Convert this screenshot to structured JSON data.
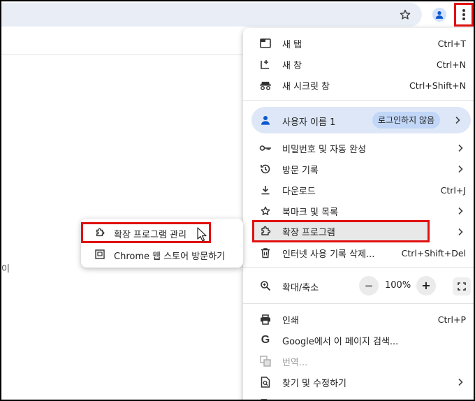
{
  "toolbar": {
    "bookmark_icon": "star-icon",
    "profile_icon": "profile-icon",
    "menu_icon": "kebab-menu-icon"
  },
  "page": {
    "fragment_text": "이"
  },
  "menu": {
    "new_tab": {
      "label": "새 탭",
      "shortcut": "Ctrl+T"
    },
    "new_window": {
      "label": "새 창",
      "shortcut": "Ctrl+N"
    },
    "incognito": {
      "label": "새 시크릿 창",
      "shortcut": "Ctrl+Shift+N"
    },
    "profile": {
      "name": "사용자 이름 1",
      "badge": "로그인하지 않음"
    },
    "passwords": {
      "label": "비밀번호 및 자동 완성"
    },
    "history": {
      "label": "방문 기록"
    },
    "downloads": {
      "label": "다운로드",
      "shortcut": "Ctrl+J"
    },
    "bookmarks": {
      "label": "북마크 및 목록"
    },
    "extensions": {
      "label": "확장 프로그램"
    },
    "clear_data": {
      "label": "인터넷 사용 기록 삭제...",
      "shortcut": "Ctrl+Shift+Del"
    },
    "zoom": {
      "label": "확대/축소",
      "minus": "−",
      "value": "100%",
      "plus": "+"
    },
    "print": {
      "label": "인쇄",
      "shortcut": "Ctrl+P"
    },
    "search_google": {
      "label": "Google에서 이 페이지 검색..."
    },
    "translate": {
      "label": "번역..."
    },
    "find_edit": {
      "label": "찾기 및 수정하기"
    }
  },
  "submenu": {
    "manage_extensions": {
      "label": "확장 프로그램 관리"
    },
    "web_store": {
      "label": "Chrome 웹 스토어 방문하기"
    }
  },
  "colors": {
    "highlight_box": "#e11010",
    "profile_row": "#dde7f7",
    "badge": "#c2d7f7",
    "avatar": "#0b57d0"
  }
}
